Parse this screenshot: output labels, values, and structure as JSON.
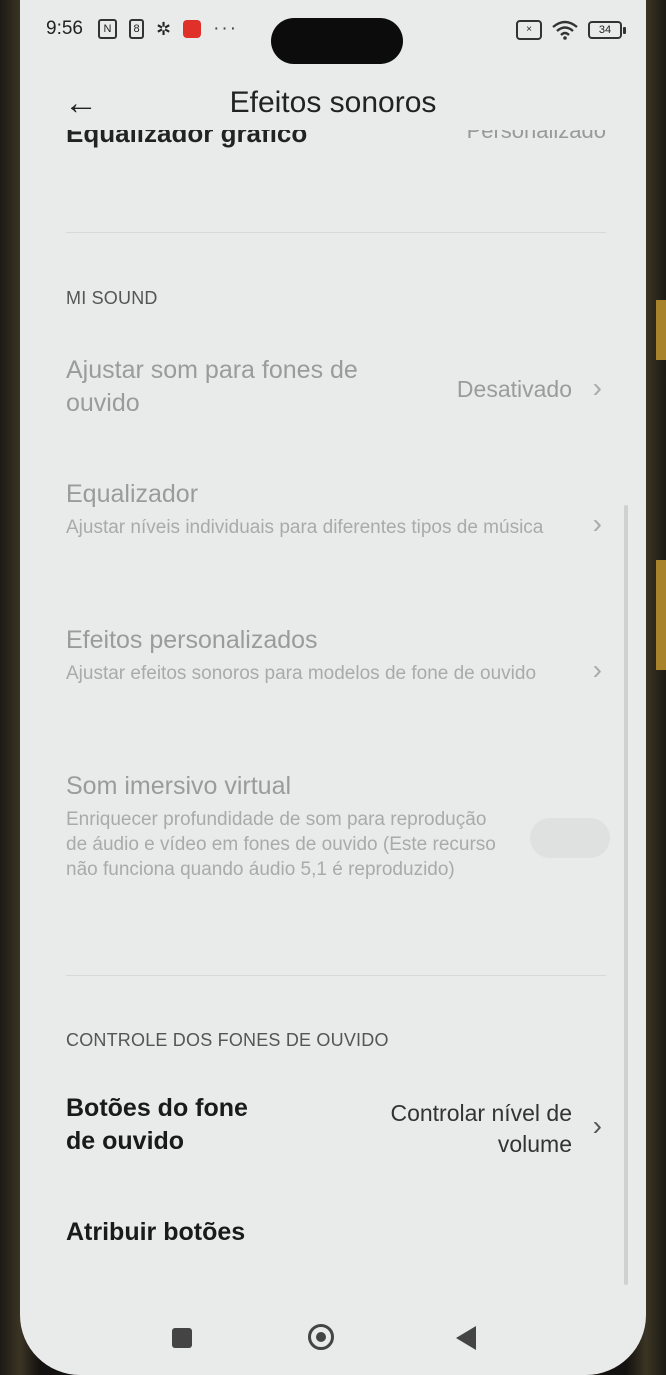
{
  "status_bar": {
    "time": "9:56",
    "battery": "34"
  },
  "header": {
    "title": "Efeitos sonoros"
  },
  "clipped_row": {
    "label": "Equalizador gráfico",
    "value": "Personalizado"
  },
  "mi_sound": {
    "section_label": "MI SOUND",
    "items": [
      {
        "title": "Ajustar som para fones de ouvido",
        "value": "Desativado"
      },
      {
        "title": "Equalizador",
        "subtitle": "Ajustar níveis individuais para diferentes tipos de música"
      },
      {
        "title": "Efeitos personalizados",
        "subtitle": "Ajustar efeitos sonoros para modelos de fone de ouvido"
      },
      {
        "title": "Som imersivo virtual",
        "subtitle": "Enriquecer profundidade de som para reprodução de áudio e vídeo em fones de ouvido (Este recurso não funciona quando áudio 5,1 é reproduzido)",
        "toggle_on": false
      }
    ]
  },
  "earphone_controls": {
    "section_label": "CONTROLE DOS FONES DE OUVIDO",
    "items": [
      {
        "title": "Botões do fone de ouvido",
        "value": "Controlar nível de volume"
      },
      {
        "title": "Atribuir botões"
      }
    ]
  }
}
